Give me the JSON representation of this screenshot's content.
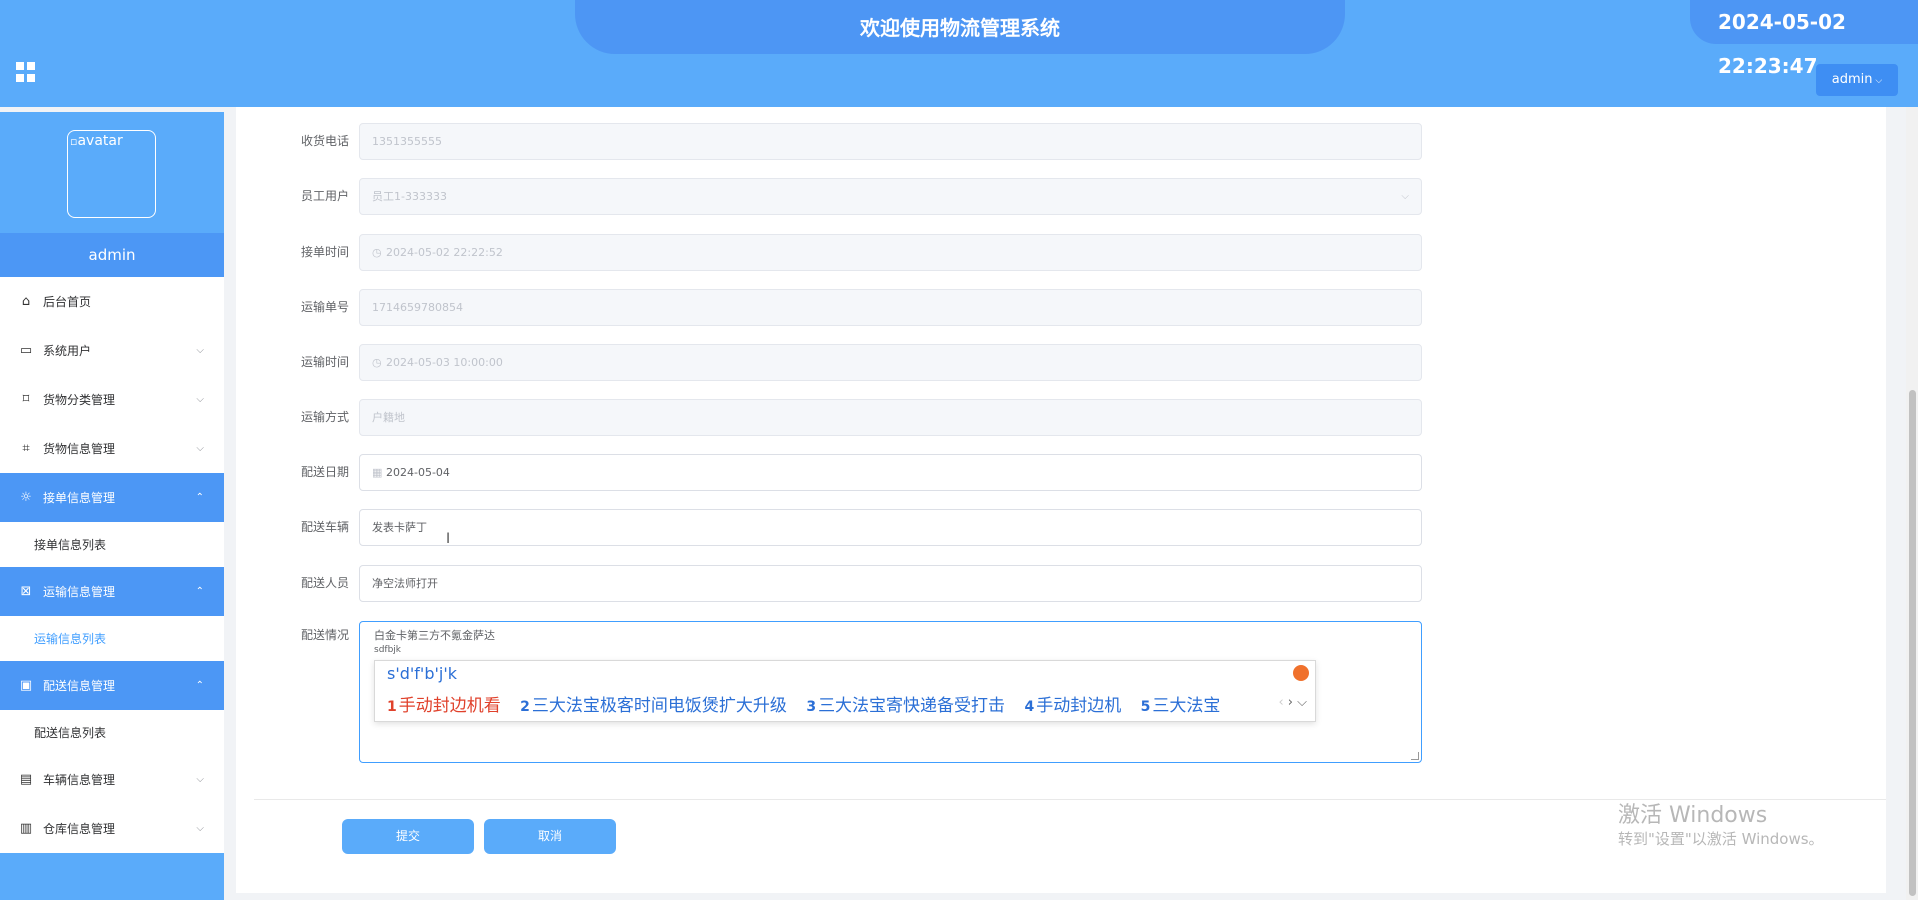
{
  "header": {
    "title": "欢迎使用物流管理系统",
    "datetime": "2024-05-02 22:23:47",
    "user_menu_label": "admin",
    "colors": {
      "bar": "#5aabfa",
      "tab": "#4d96f4"
    }
  },
  "sidebar": {
    "avatar_alt": "avatar",
    "username": "admin",
    "items": [
      {
        "label": "后台首页",
        "icon": "home-icon",
        "expandable": false
      },
      {
        "label": "系统用户",
        "icon": "laptop-icon",
        "expandable": true
      },
      {
        "label": "货物分类管理",
        "icon": "bookmark-icon",
        "expandable": true
      },
      {
        "label": "货物信息管理",
        "icon": "tag-icon",
        "expandable": true
      },
      {
        "label": "接单信息管理",
        "icon": "sun-icon",
        "expandable": true,
        "open": true,
        "sub": "接单信息列表"
      },
      {
        "label": "运输信息管理",
        "icon": "inbox-icon",
        "expandable": true,
        "open": true,
        "sub": "运输信息列表"
      },
      {
        "label": "配送信息管理",
        "icon": "clipboard-icon",
        "expandable": true,
        "open": true,
        "sub": "配送信息列表"
      },
      {
        "label": "车辆信息管理",
        "icon": "message-icon",
        "expandable": true
      },
      {
        "label": "仓库信息管理",
        "icon": "archive-icon",
        "expandable": true
      }
    ],
    "active_sub": "运输信息列表"
  },
  "form": {
    "fields": [
      {
        "label": "收货电话",
        "value": "1351355555",
        "disabled": true
      },
      {
        "label": "员工用户",
        "value": "员工1-333333",
        "disabled": true,
        "type": "select"
      },
      {
        "label": "接单时间",
        "value": "2024-05-02 22:22:52",
        "disabled": true,
        "icon": "clock-icon"
      },
      {
        "label": "运输单号",
        "value": "1714659780854",
        "disabled": true
      },
      {
        "label": "运输时间",
        "value": "2024-05-03 10:00:00",
        "disabled": true,
        "icon": "clock-icon"
      },
      {
        "label": "运输方式",
        "value": "户籍地",
        "disabled": true
      },
      {
        "label": "配送日期",
        "value": "2024-05-04",
        "disabled": false,
        "icon": "calendar-icon"
      },
      {
        "label": "配送车辆",
        "value": "发表卡萨丁",
        "disabled": false
      },
      {
        "label": "配送人员",
        "value": "净空法师打开",
        "disabled": false
      }
    ],
    "situation": {
      "label": "配送情况",
      "line1": "白金卡第三方不氪金萨达",
      "line2": "sdfbjk"
    },
    "submit_label": "提交",
    "cancel_label": "取消"
  },
  "ime": {
    "composition": "s'd'f'b'j'k",
    "candidates": [
      {
        "n": "1",
        "text": "手动封边机看"
      },
      {
        "n": "2",
        "text": "三大法宝极客时间电饭煲扩大升级"
      },
      {
        "n": "3",
        "text": "三大法宝寄快递备受打击"
      },
      {
        "n": "4",
        "text": "手动封边机"
      },
      {
        "n": "5",
        "text": "三大法宝"
      }
    ]
  },
  "watermark": {
    "line1": "激活 Windows",
    "line2": "转到\"设置\"以激活 Windows。"
  }
}
